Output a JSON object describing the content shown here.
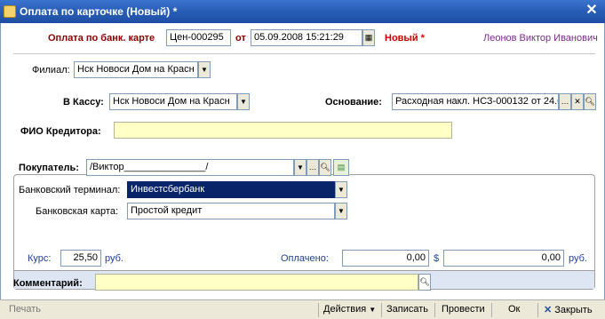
{
  "window": {
    "title": "Оплата по карточке (Новый) *",
    "close_glyph": "✕"
  },
  "header": {
    "doc_label": "Оплата по банк. карте",
    "number": "Цен-000295",
    "from_label": "от",
    "date": "05.09.2008 15:21:29",
    "status": "Новый *",
    "user": "Леонов Виктор Иванович"
  },
  "form": {
    "branch_label": "Филиал:",
    "branch_value": "Нск Новоси Дом на Красн",
    "cashbox_label": "В Кассу:",
    "cashbox_value": "Нск Новоси Дом на Красн",
    "basis_label": "Основание:",
    "basis_value": "Расходная накл. НСЗ-000132 от 24.0",
    "creditor_label": "ФИО Кредитора:",
    "creditor_value": ""
  },
  "buyer": {
    "buyer_label": "Покупатель:",
    "buyer_value": "/Виктор_______________/",
    "terminal_label": "Банковский терминал:",
    "terminal_value": "Инвестсбербанк",
    "card_label": "Банковская карта:",
    "card_value": "Простой кредит"
  },
  "rate": {
    "rate_label": "Курс:",
    "rate_value": "25,50",
    "rate_currency": "руб.",
    "paid_label": "Оплачено:",
    "paid_value": "0,00",
    "usd_sign": "$",
    "paid_rub_value": "0,00",
    "paid_rub_currency": "руб."
  },
  "comment": {
    "label": "Комментарий:",
    "value": ""
  },
  "footer": {
    "print": "Печать",
    "actions": "Действия",
    "save": "Записать",
    "post": "Провести",
    "ok": "Ок",
    "close": "Закрыть"
  },
  "colors": {
    "title_bar": "#2a5fb8",
    "yellow_field": "#ffffc6",
    "status_red": "#d00000",
    "doc_label": "#8b0000",
    "user": "#7a2b8a"
  }
}
